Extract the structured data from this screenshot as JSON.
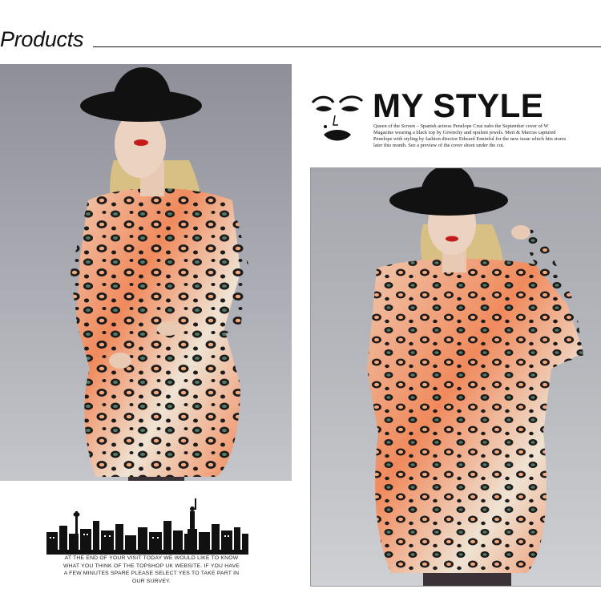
{
  "header": {
    "title": "Products"
  },
  "my_style": {
    "heading": "MY STYLE",
    "text": "Queen of the Screen – Spanish actress Penelope Cruz nabs the September cover of W Magazine wearing a black top by Givenchy and opulent jewels. Mert & Marcus captured Penelope with styling by fashion director Edward Enninful for the new issue which hits stores later this month. See a preview of the cover shoot under the cut."
  },
  "survey": {
    "text": "AT THE END OF YOUR VISIT TODAY WE WOULD LIKE TO KNOW WHAT YOU THINK OF THE TOPSHOP UK WEBSITE. IF YOU HAVE A FEW MINUTES SPARE PLEASE SELECT YES TO TAKE PART IN OUR SURVEY."
  },
  "colors": {
    "leopard_orange": "#f08a5d",
    "leopard_cream": "#efe3d3",
    "leopard_green": "#7fc9a2",
    "hat": "#111111",
    "hair": "#d8bf83",
    "skin": "#e8c9b4",
    "lips": "#c41a1a",
    "backdrop": "#a9a9b0"
  },
  "icons": {
    "face": "marilyn-face-icon",
    "skyline": "city-skyline-icon"
  }
}
